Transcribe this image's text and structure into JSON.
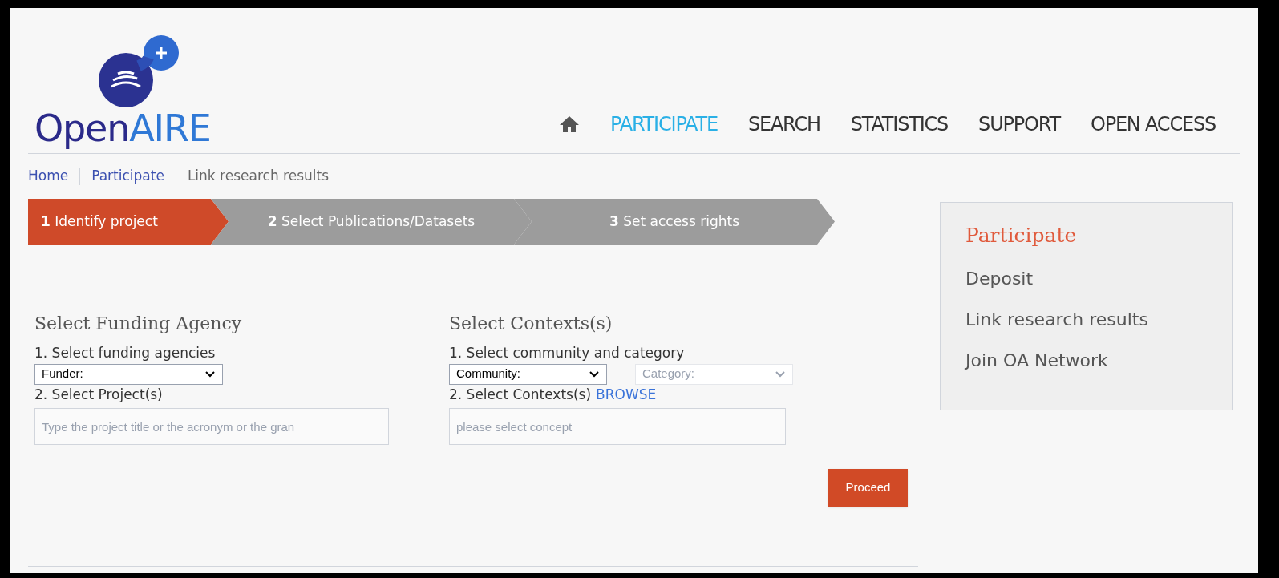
{
  "logo": {
    "parts": [
      "Open",
      "AIRE"
    ]
  },
  "nav": [
    {
      "label": "PARTICIPATE",
      "selected": true
    },
    {
      "label": "SEARCH",
      "selected": false
    },
    {
      "label": "STATISTICS",
      "selected": false
    },
    {
      "label": "SUPPORT",
      "selected": false
    },
    {
      "label": "OPEN ACCESS",
      "selected": false
    }
  ],
  "breadcrumb": [
    {
      "label": "Home",
      "link": true
    },
    {
      "label": "Participate",
      "link": true
    },
    {
      "label": "Link research results",
      "link": false
    }
  ],
  "steps": [
    {
      "label": "**1** Identify project",
      "selected": true
    },
    {
      "label": "**2** Select Publications/Datasets",
      "selected": false
    },
    {
      "label": "**3** Set access rights",
      "selected": false
    }
  ],
  "funding": {
    "title": "Select Funding Agency",
    "step1": "1. Select funding agencies",
    "funder": {
      "value": "Funder:",
      "disabled": false
    },
    "step2": "2. Select Project(s)",
    "project": {
      "placeholder": "Type the project title or the acronym or the gran"
    }
  },
  "contexts": {
    "title": "Select Contexts(s)",
    "step1": "1. Select community and category",
    "community": {
      "value": "Community:",
      "disabled": false
    },
    "category": {
      "value": "Category:",
      "disabled": true
    },
    "step2": "2. Select Contexts(s)",
    "browse": "BROWSE",
    "concept": {
      "placeholder": "please select concept"
    }
  },
  "proceed": "Proceed",
  "sidebar": {
    "title": "Participate",
    "items": [
      "Deposit",
      "Link research results",
      "Join OA Network"
    ]
  }
}
